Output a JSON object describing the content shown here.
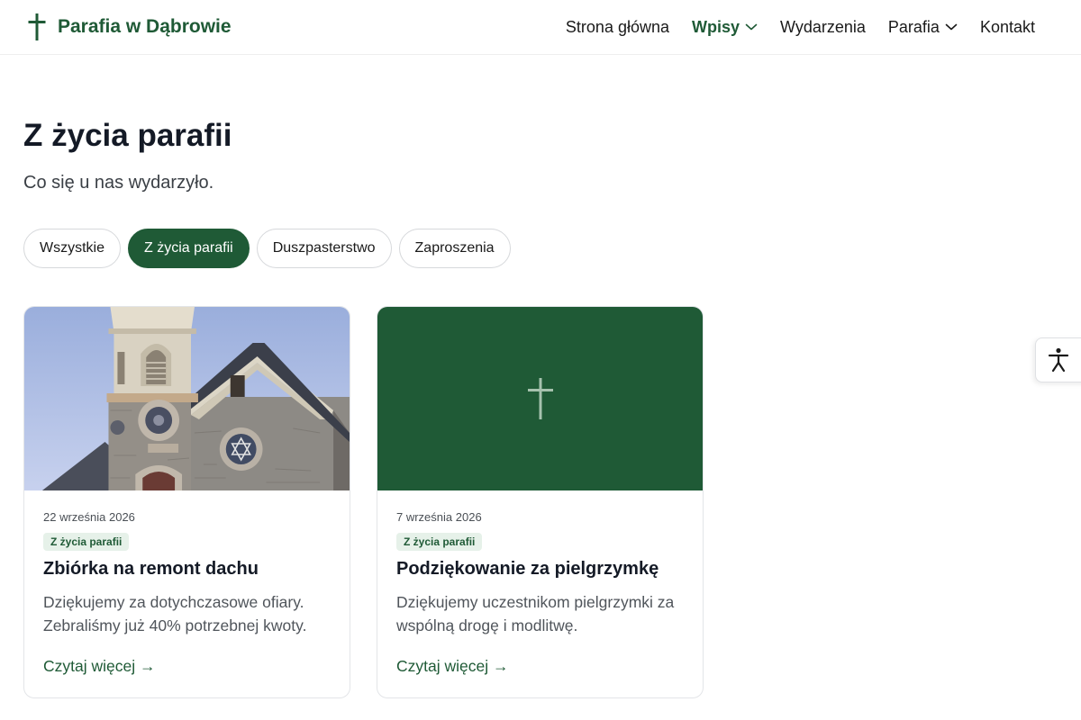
{
  "header": {
    "brand": "Parafia w Dąbrowie",
    "nav": [
      {
        "label": "Strona główna"
      },
      {
        "label": "Wpisy"
      },
      {
        "label": "Wydarzenia"
      },
      {
        "label": "Parafia"
      },
      {
        "label": "Kontakt"
      }
    ]
  },
  "main": {
    "title": "Z życia parafii",
    "subtitle": "Co się u nas wydarzyło.",
    "filters": [
      {
        "label": "Wszystkie"
      },
      {
        "label": "Z życia parafii"
      },
      {
        "label": "Duszpasterstwo"
      },
      {
        "label": "Zaproszenia"
      }
    ],
    "posts": [
      {
        "date": "22 września 2026",
        "category": "Z życia parafii",
        "title": "Zbiórka na remont dachu",
        "excerpt": "Dziękujemy za dotychczasowe ofiary. Zebraliśmy już 40% potrzebnej kwoty.",
        "link": "Czytaj więcej →"
      },
      {
        "date": "7 września 2026",
        "category": "Z życia parafii",
        "title": "Podziękowanie za pielgrzymkę",
        "excerpt": "Dziękujemy uczestnikom pielgrzymki za wspólną drogę i modlitwę.",
        "link": "Czytaj więcej →"
      }
    ]
  },
  "icons": {
    "brand": "cross-icon",
    "dropdown": "chevron-down-icon",
    "placeholder": "cross-icon",
    "accessibility": "accessibility-icon"
  },
  "colors": {
    "brand": "#1f5a36",
    "tag_background": "#e6f1e9",
    "text": "#141a26"
  }
}
